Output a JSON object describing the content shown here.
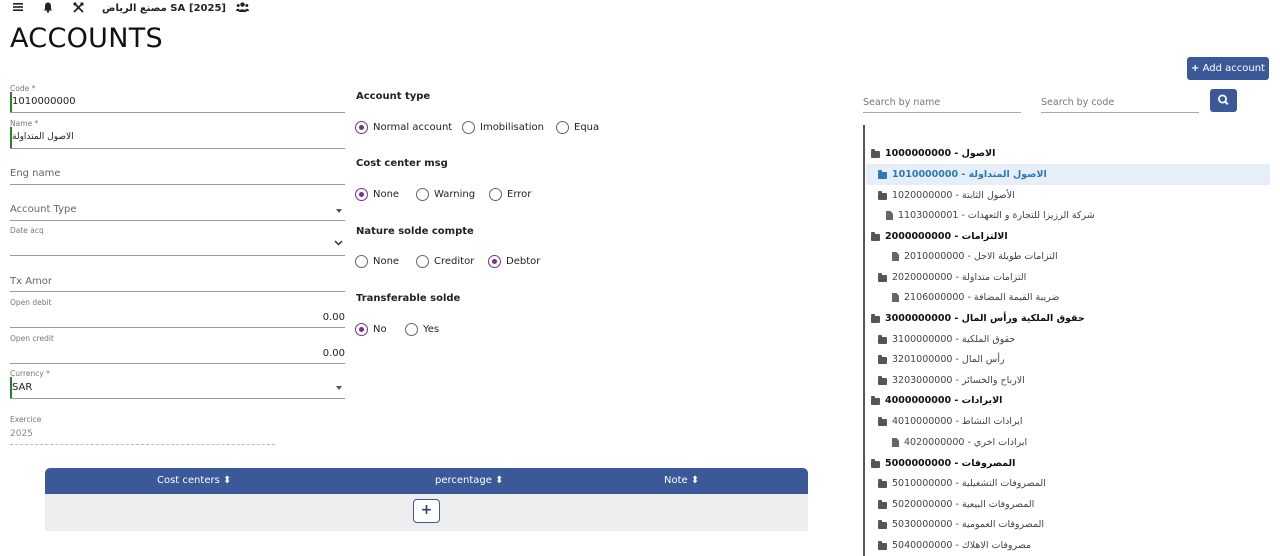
{
  "topbar": {
    "company": "مصنع الرياض SA",
    "year": "[2025]"
  },
  "page": {
    "title": "ACCOUNTS"
  },
  "form": {
    "code_label": "Code *",
    "code_value": "1010000000",
    "name_label": "Name *",
    "name_value": "الاصول المتداولة",
    "eng_name_placeholder": "Eng name",
    "account_type_placeholder": "Account Type",
    "date_acq_label": "Date acq",
    "tx_amor_placeholder": "Tx Amor",
    "open_debit_label": "Open debit",
    "open_debit_value": "0.00",
    "open_credit_label": "Open credit",
    "open_credit_value": "0.00",
    "currency_label": "Currency *",
    "currency_value": "SAR",
    "exercice_label": "Exercice",
    "exercice_value": "2025"
  },
  "radio_groups": {
    "account_type": {
      "title": "Account type",
      "options": [
        "Normal account",
        "Imobilisation",
        "Equa"
      ],
      "selected": "Normal account"
    },
    "cost_center_msg": {
      "title": "Cost center msg",
      "options": [
        "None",
        "Warning",
        "Error"
      ],
      "selected": "None"
    },
    "nature_solde": {
      "title": "Nature solde compte",
      "options": [
        "None",
        "Creditor",
        "Debtor"
      ],
      "selected": "Debtor"
    },
    "transferable_solde": {
      "title": "Transferable solde",
      "options": [
        "No",
        "Yes"
      ],
      "selected": "No"
    }
  },
  "cost_table": {
    "columns": [
      "Cost centers",
      "percentage",
      "Note"
    ],
    "add_label": "+"
  },
  "right_panel": {
    "add_account_label": "Add account",
    "search_name_placeholder": "Search by name",
    "search_code_placeholder": "Search by code"
  },
  "tree": [
    {
      "label": "الاصول - 1000000000",
      "type": "root"
    },
    {
      "label": "الاصول المتداولة - 1010000000",
      "type": "folder",
      "selected": true
    },
    {
      "label": "الأصول الثابتة - 1020000000",
      "type": "folder"
    },
    {
      "label": "شركة الرزيزا للتجارة و التعهدات - 1103000001",
      "type": "file"
    },
    {
      "label": "الالتزامات - 2000000000",
      "type": "root"
    },
    {
      "label": "التزامات طويلة الاجل - 2010000000",
      "type": "file"
    },
    {
      "label": "التزامات متداولة - 2020000000",
      "type": "folder"
    },
    {
      "label": "ضريبة القيمة المضافة - 2106000000",
      "type": "file"
    },
    {
      "label": "حقوق الملكية ورأس المال - 3000000000",
      "type": "root"
    },
    {
      "label": "حقوق الملكية - 3100000000",
      "type": "folder"
    },
    {
      "label": "رأس المال - 3201000000",
      "type": "folder"
    },
    {
      "label": "الارباح والخسائر - 3203000000",
      "type": "folder"
    },
    {
      "label": "الايرادات - 4000000000",
      "type": "root"
    },
    {
      "label": "ايرادات النشاط - 4010000000",
      "type": "folder"
    },
    {
      "label": "ايرادات اخري - 4020000000",
      "type": "file"
    },
    {
      "label": "المصروفات - 5000000000",
      "type": "root"
    },
    {
      "label": "المصروفات التشغيلية - 5010000000",
      "type": "folder"
    },
    {
      "label": "المصروفات البيعية - 5020000000",
      "type": "folder"
    },
    {
      "label": "المصروفات العمومية - 5030000000",
      "type": "folder"
    },
    {
      "label": "مصروفات الاهلاك - 5040000000",
      "type": "folder"
    }
  ],
  "icons": {
    "menu": "menu-icon",
    "bell": "bell-icon",
    "tools": "tools-icon",
    "users": "users-icon",
    "search": "search-icon",
    "folder": "folder-icon",
    "file": "file-icon",
    "sort": "sort-icon"
  },
  "colors": {
    "primary": "#3b5998",
    "radio_selected": "#7b2d8b",
    "tree_selected": "#2a7ab8",
    "field_accent": "#2e7d32"
  }
}
